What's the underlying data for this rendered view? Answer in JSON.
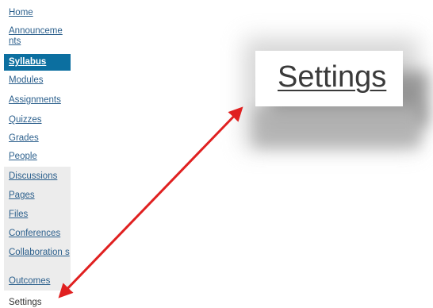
{
  "nav": {
    "items": [
      {
        "label": "Home"
      },
      {
        "label": "Announceme nts"
      },
      {
        "label": "Syllabus"
      },
      {
        "label": "Modules"
      },
      {
        "label": "Assignments"
      },
      {
        "label": "Quizzes"
      },
      {
        "label": "Grades"
      },
      {
        "label": "People"
      },
      {
        "label": "Discussions"
      },
      {
        "label": "Pages"
      },
      {
        "label": "Files"
      },
      {
        "label": "Conferences"
      },
      {
        "label": "Collaboration s"
      },
      {
        "label": "Outcomes"
      },
      {
        "label": "Settings"
      }
    ]
  },
  "zoom": {
    "label": "Settings"
  },
  "colors": {
    "active_bg": "#0c6fa0",
    "link": "#2b5f8c",
    "arrow": "#e02020"
  }
}
